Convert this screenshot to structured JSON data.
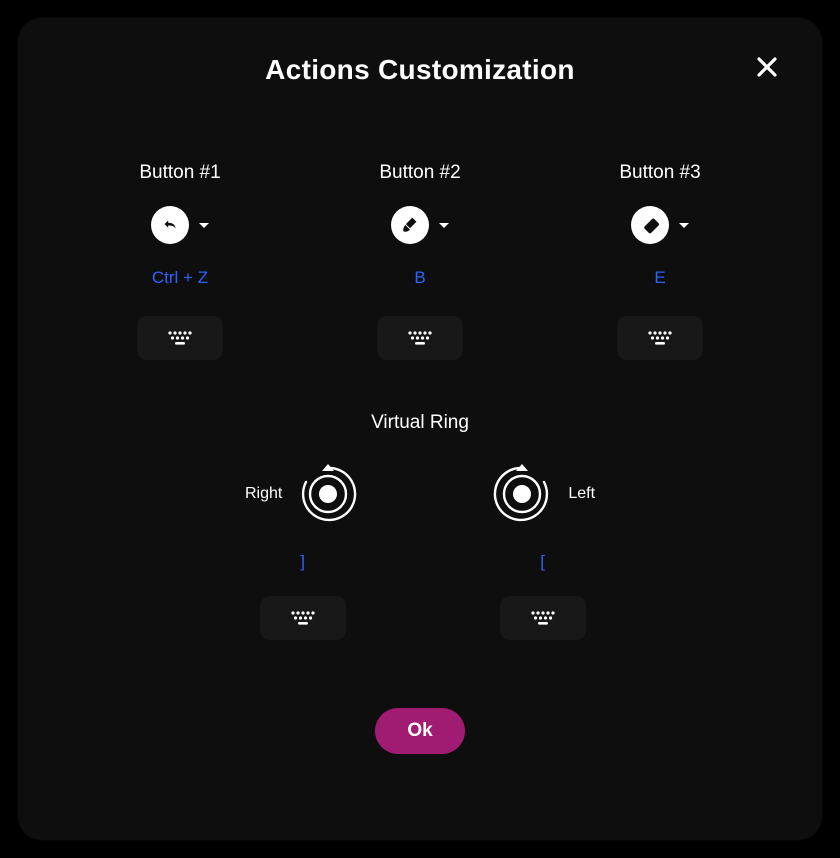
{
  "modal": {
    "title": "Actions Customization"
  },
  "buttons": [
    {
      "title": "Button #1",
      "shortcut": "Ctrl + Z",
      "icon": "undo-icon"
    },
    {
      "title": "Button #2",
      "shortcut": "B",
      "icon": "brush-icon"
    },
    {
      "title": "Button #3",
      "shortcut": "E",
      "icon": "eraser-icon"
    }
  ],
  "ring": {
    "title": "Virtual Ring",
    "right": {
      "label": "Right",
      "shortcut": "]"
    },
    "left": {
      "label": "Left",
      "shortcut": "["
    }
  },
  "ok_label": "Ok"
}
